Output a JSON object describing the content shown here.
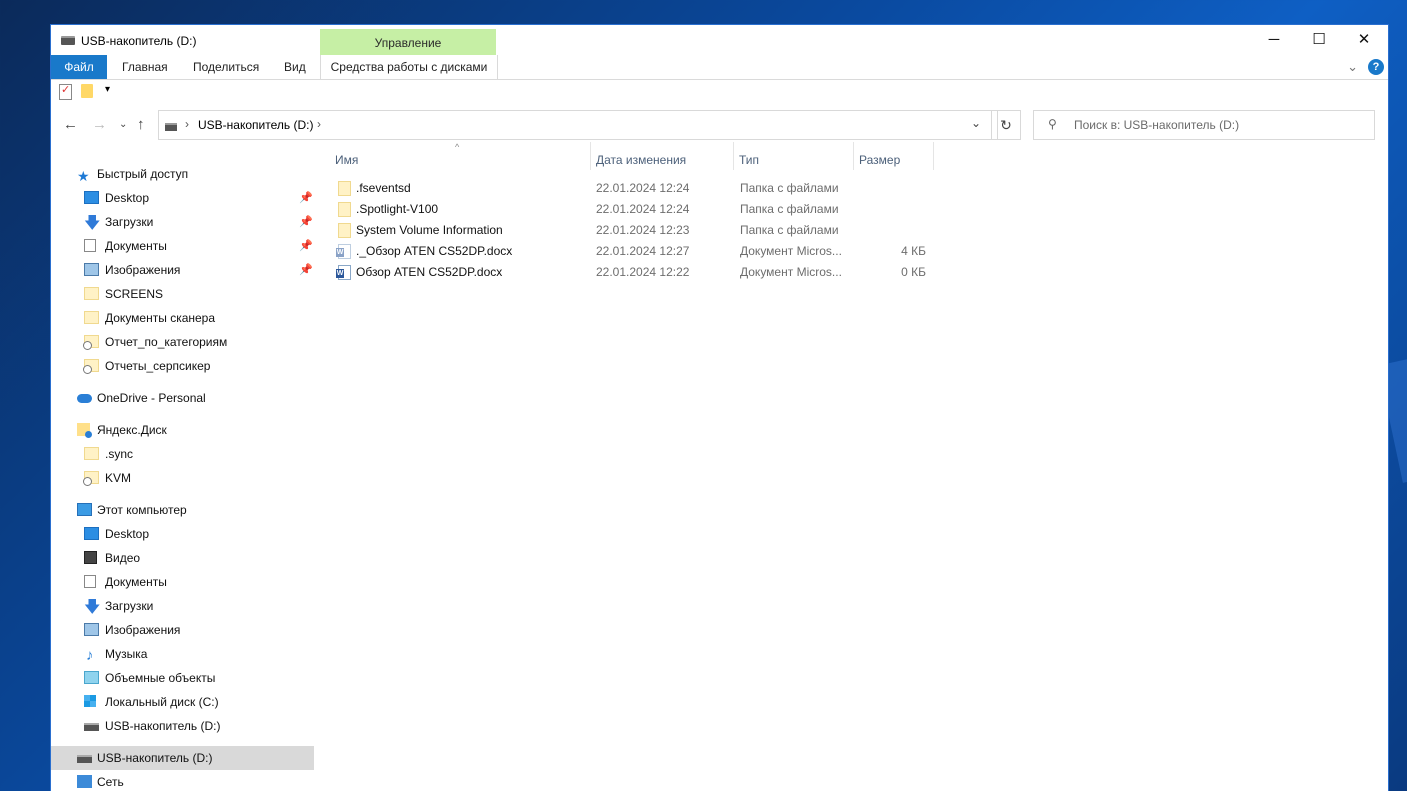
{
  "window": {
    "title": "USB-накопитель (D:)",
    "controls": {
      "minimize": "─",
      "maximize": "☐",
      "close": "✕"
    }
  },
  "ribbon": {
    "context_group": "Управление",
    "tabs": [
      "Файл",
      "Главная",
      "Поделиться",
      "Вид",
      "Средства работы с дисками"
    ]
  },
  "address": {
    "path": "USB-накопитель (D:)",
    "search_placeholder": "Поиск в: USB-накопитель (D:)"
  },
  "sidebar": {
    "quick_access": {
      "label": "Быстрый доступ",
      "items": [
        {
          "label": "Desktop",
          "icon": "desktop-icon",
          "pinned": true
        },
        {
          "label": "Загрузки",
          "icon": "downloads-icon",
          "pinned": true
        },
        {
          "label": "Документы",
          "icon": "documents-icon",
          "pinned": true
        },
        {
          "label": "Изображения",
          "icon": "pictures-icon",
          "pinned": true
        },
        {
          "label": "SCREENS",
          "icon": "folder-icon",
          "pinned": false
        },
        {
          "label": "Документы сканера",
          "icon": "folder-icon",
          "pinned": false
        },
        {
          "label": "Отчет_по_категориям",
          "icon": "folder-link-icon",
          "pinned": false
        },
        {
          "label": "Отчеты_серпсикер",
          "icon": "folder-link-icon",
          "pinned": false
        }
      ]
    },
    "onedrive": {
      "label": "OneDrive - Personal"
    },
    "yandex": {
      "label": "Яндекс.Диск",
      "items": [
        {
          "label": ".sync",
          "icon": "folder-icon"
        },
        {
          "label": "KVM",
          "icon": "folder-link-icon"
        }
      ]
    },
    "this_pc": {
      "label": "Этот компьютер",
      "items": [
        {
          "label": "Desktop",
          "icon": "desktop-icon"
        },
        {
          "label": "Видео",
          "icon": "video-icon"
        },
        {
          "label": "Документы",
          "icon": "documents-icon"
        },
        {
          "label": "Загрузки",
          "icon": "downloads-icon"
        },
        {
          "label": "Изображения",
          "icon": "pictures-icon"
        },
        {
          "label": "Музыка",
          "icon": "music-icon"
        },
        {
          "label": "Объемные объекты",
          "icon": "3d-objects-icon"
        },
        {
          "label": "Локальный диск (C:)",
          "icon": "windows-drive-icon"
        },
        {
          "label": "USB-накопитель (D:)",
          "icon": "usb-drive-icon"
        }
      ]
    },
    "usb_root": {
      "label": "USB-накопитель (D:)"
    },
    "network": {
      "label": "Сеть"
    }
  },
  "columns": {
    "name": "Имя",
    "date": "Дата изменения",
    "type": "Тип",
    "size": "Размер"
  },
  "files": [
    {
      "name": ".fseventsd",
      "date": "22.01.2024 12:24",
      "type": "Папка с файлами",
      "size": "",
      "icon": "folder-icon"
    },
    {
      "name": ".Spotlight-V100",
      "date": "22.01.2024 12:24",
      "type": "Папка с файлами",
      "size": "",
      "icon": "folder-icon"
    },
    {
      "name": "System Volume Information",
      "date": "22.01.2024 12:23",
      "type": "Папка с файлами",
      "size": "",
      "icon": "folder-icon"
    },
    {
      "name": "._Обзор ATEN CS52DP.docx",
      "date": "22.01.2024 12:27",
      "type": "Документ Micros...",
      "size": "4 КБ",
      "icon": "word-doc-icon"
    },
    {
      "name": "Обзор ATEN CS52DP.docx",
      "date": "22.01.2024 12:22",
      "type": "Документ Micros...",
      "size": "0 КБ",
      "icon": "word-doc-icon"
    }
  ]
}
